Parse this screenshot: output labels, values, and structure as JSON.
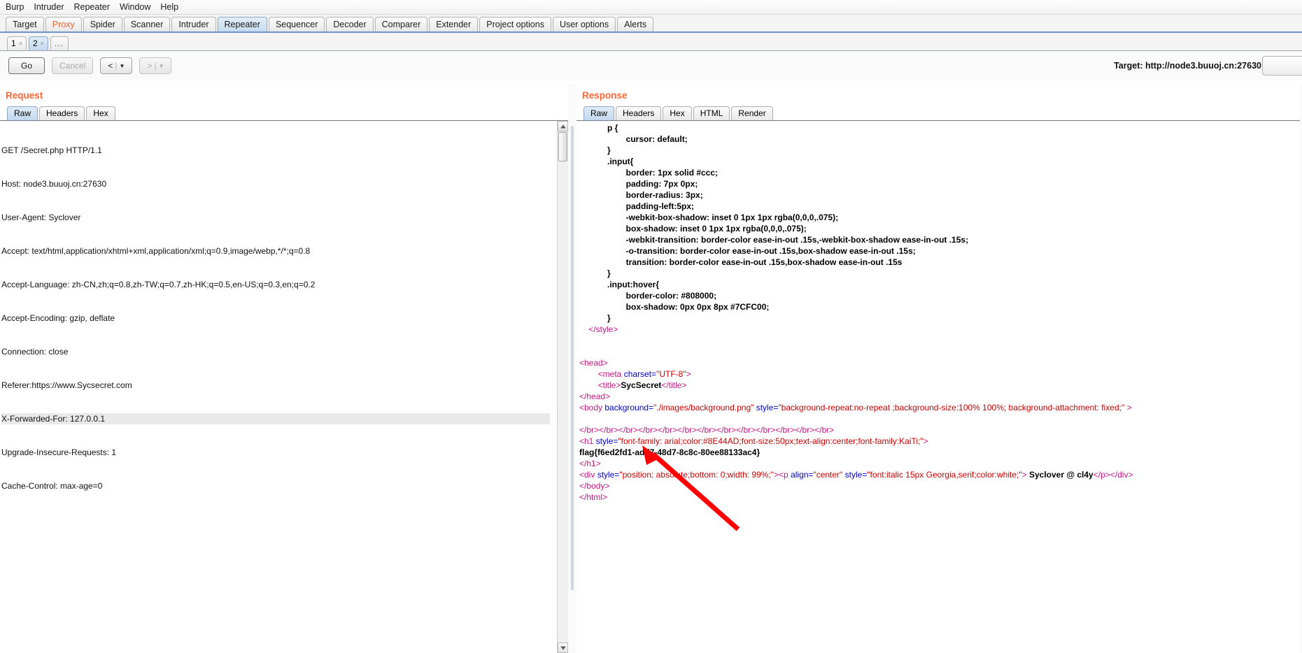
{
  "menubar": {
    "items": [
      "Burp",
      "Intruder",
      "Repeater",
      "Window",
      "Help"
    ]
  },
  "main_tabs": [
    {
      "label": "Target",
      "selected": false,
      "accent": false
    },
    {
      "label": "Proxy",
      "selected": false,
      "accent": true
    },
    {
      "label": "Spider",
      "selected": false,
      "accent": false
    },
    {
      "label": "Scanner",
      "selected": false,
      "accent": false
    },
    {
      "label": "Intruder",
      "selected": false,
      "accent": false
    },
    {
      "label": "Repeater",
      "selected": true,
      "accent": false
    },
    {
      "label": "Sequencer",
      "selected": false,
      "accent": false
    },
    {
      "label": "Decoder",
      "selected": false,
      "accent": false
    },
    {
      "label": "Comparer",
      "selected": false,
      "accent": false
    },
    {
      "label": "Extender",
      "selected": false,
      "accent": false
    },
    {
      "label": "Project options",
      "selected": false,
      "accent": false
    },
    {
      "label": "User options",
      "selected": false,
      "accent": false
    },
    {
      "label": "Alerts",
      "selected": false,
      "accent": false
    }
  ],
  "sub_tabs": [
    {
      "label": "1",
      "close": "×",
      "selected": false
    },
    {
      "label": "2",
      "close": "×",
      "selected": true
    },
    {
      "label": "...",
      "close": "",
      "selected": false
    }
  ],
  "toolbar": {
    "go_label": "Go",
    "cancel_label": "Cancel",
    "back_label": "<",
    "forward_label": ">",
    "sep": "|",
    "caret": "▼",
    "target_label": "Target: http://node3.buuoj.cn:27630"
  },
  "request": {
    "title": "Request",
    "tabs": [
      {
        "label": "Raw",
        "selected": true
      },
      {
        "label": "Headers",
        "selected": false
      },
      {
        "label": "Hex",
        "selected": false
      }
    ],
    "lines": [
      {
        "text": "GET /Secret.php HTTP/1.1",
        "highlight": false
      },
      {
        "text": "Host: node3.buuoj.cn:27630",
        "highlight": false
      },
      {
        "text": "User-Agent: Syclover",
        "highlight": false
      },
      {
        "text": "Accept: text/html,application/xhtml+xml,application/xml;q=0.9,image/webp,*/*;q=0.8",
        "highlight": false
      },
      {
        "text": "Accept-Language: zh-CN,zh;q=0.8,zh-TW;q=0.7,zh-HK;q=0.5,en-US;q=0.3,en;q=0.2",
        "highlight": false
      },
      {
        "text": "Accept-Encoding: gzip, deflate",
        "highlight": false
      },
      {
        "text": "Connection: close",
        "highlight": false
      },
      {
        "text": "Referer:https://www.Sycsecret.com",
        "highlight": false
      },
      {
        "text": "X-Forwarded-For: 127.0.0.1",
        "highlight": true
      },
      {
        "text": "Upgrade-Insecure-Requests: 1",
        "highlight": false
      },
      {
        "text": "Cache-Control: max-age=0",
        "highlight": false
      }
    ]
  },
  "response": {
    "title": "Response",
    "tabs": [
      {
        "label": "Raw",
        "selected": true
      },
      {
        "label": "Headers",
        "selected": false
      },
      {
        "label": "Hex",
        "selected": false
      },
      {
        "label": "HTML",
        "selected": false
      },
      {
        "label": "Render",
        "selected": false
      }
    ],
    "lines": [
      [
        {
          "t": "            p {",
          "c": "css"
        }
      ],
      [
        {
          "t": "                    cursor: default;",
          "c": "css"
        }
      ],
      [
        {
          "t": "            }",
          "c": "css"
        }
      ],
      [
        {
          "t": "            .input{",
          "c": "css"
        }
      ],
      [
        {
          "t": "                    border: 1px solid #ccc;",
          "c": "css"
        }
      ],
      [
        {
          "t": "                    padding: 7px 0px;",
          "c": "css"
        }
      ],
      [
        {
          "t": "                    border-radius: 3px;",
          "c": "css"
        }
      ],
      [
        {
          "t": "                    padding-left:5px;",
          "c": "css"
        }
      ],
      [
        {
          "t": "                    -webkit-box-shadow: inset 0 1px 1px rgba(0,0,0,.075);",
          "c": "css"
        }
      ],
      [
        {
          "t": "                    box-shadow: inset 0 1px 1px rgba(0,0,0,.075);",
          "c": "css"
        }
      ],
      [
        {
          "t": "                    -webkit-transition: border-color ease-in-out .15s,-webkit-box-shadow ease-in-out .15s;",
          "c": "css"
        }
      ],
      [
        {
          "t": "                    -o-transition: border-color ease-in-out .15s,box-shadow ease-in-out .15s;",
          "c": "css"
        }
      ],
      [
        {
          "t": "                    transition: border-color ease-in-out .15s,box-shadow ease-in-out .15s",
          "c": "css"
        }
      ],
      [
        {
          "t": "            }",
          "c": "css"
        }
      ],
      [
        {
          "t": "            .input:hover{",
          "c": "css"
        }
      ],
      [
        {
          "t": "                    border-color: #808000;",
          "c": "css"
        }
      ],
      [
        {
          "t": "                    box-shadow: 0px 0px 8px #7CFC00;",
          "c": "css"
        }
      ],
      [
        {
          "t": "            }",
          "c": "css"
        }
      ],
      [
        {
          "t": "    ",
          "c": "plain"
        },
        {
          "t": "</style>",
          "c": "tagname"
        }
      ],
      [
        {
          "t": "",
          "c": "plain"
        }
      ],
      [
        {
          "t": "",
          "c": "plain"
        }
      ],
      [
        {
          "t": "<head>",
          "c": "tagname"
        }
      ],
      [
        {
          "t": "        ",
          "c": "plain"
        },
        {
          "t": "<meta ",
          "c": "tagname"
        },
        {
          "t": "charset=",
          "c": "attr"
        },
        {
          "t": "\"UTF-8\"",
          "c": "val"
        },
        {
          "t": ">",
          "c": "tagname"
        }
      ],
      [
        {
          "t": "        ",
          "c": "plain"
        },
        {
          "t": "<title>",
          "c": "tagname"
        },
        {
          "t": "SycSecret",
          "c": "plain"
        },
        {
          "t": "</title>",
          "c": "tagname"
        }
      ],
      [
        {
          "t": "</head>",
          "c": "tagname"
        }
      ],
      [
        {
          "t": "<body ",
          "c": "tagname"
        },
        {
          "t": "background=",
          "c": "attr"
        },
        {
          "t": "\"./images/background.png\"",
          "c": "val"
        },
        {
          "t": " style=",
          "c": "attr"
        },
        {
          "t": "\"background-repeat:no-repeat ;background-size:100% 100%; background-attachment: fixed;\"",
          "c": "val"
        },
        {
          "t": " >",
          "c": "tagname"
        }
      ],
      [
        {
          "t": "",
          "c": "plain"
        }
      ],
      [
        {
          "t": "</br></br></br></br></br></br></br></br></br></br></br></br></br>",
          "c": "brtag"
        }
      ],
      [
        {
          "t": "<h1 ",
          "c": "tagname"
        },
        {
          "t": "style=",
          "c": "attr"
        },
        {
          "t": "\"font-family: arial;color:#8E44AD;font-size:50px;text-align:center;font-family:KaiTi;\"",
          "c": "val"
        },
        {
          "t": ">",
          "c": "tagname"
        }
      ],
      [
        {
          "t": "flag{f6ed2fd1-add7-48d7-8c8c-80ee88133ac4}",
          "c": "flagline"
        }
      ],
      [
        {
          "t": "</h1>",
          "c": "tagname"
        }
      ],
      [
        {
          "t": "<div ",
          "c": "tagname"
        },
        {
          "t": "style=",
          "c": "attr"
        },
        {
          "t": "\"position: absolute;bottom: 0;width: 99%;\"",
          "c": "val"
        },
        {
          "t": ">",
          "c": "tagname"
        },
        {
          "t": "<p ",
          "c": "tagname"
        },
        {
          "t": "align=",
          "c": "attr"
        },
        {
          "t": "\"center\"",
          "c": "val"
        },
        {
          "t": " style=",
          "c": "attr"
        },
        {
          "t": "\"font:italic 15px Georgia,serif;color:white;\"",
          "c": "val"
        },
        {
          "t": "> ",
          "c": "tagname"
        },
        {
          "t": "Syclover @ cl4y",
          "c": "plain"
        },
        {
          "t": "</p>",
          "c": "tagname"
        },
        {
          "t": "</div>",
          "c": "tagname"
        }
      ],
      [
        {
          "t": "</body>",
          "c": "tagname"
        }
      ],
      [
        {
          "t": "</html>",
          "c": "tagname"
        }
      ]
    ]
  },
  "annotation": {
    "color": "#ff0000",
    "name": "red-arrow-pointing-to-flag"
  }
}
